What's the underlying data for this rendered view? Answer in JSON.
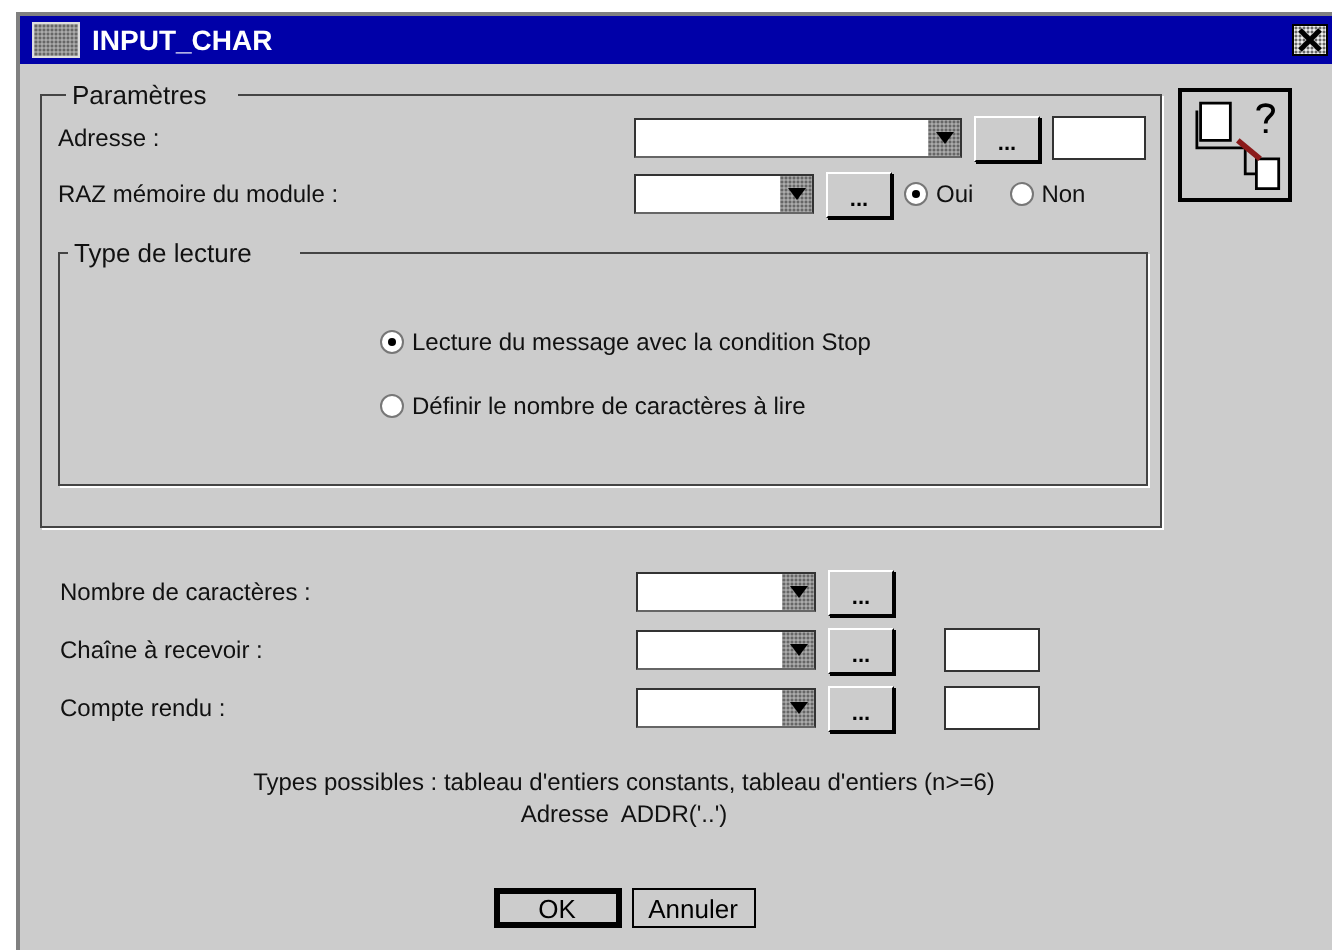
{
  "window": {
    "title": "INPUT_CHAR"
  },
  "parameters": {
    "title": "Paramètres",
    "fields": [
      {
        "kind": "wide",
        "label": "Adresse :",
        "button": "...",
        "has_box": true
      },
      {
        "kind": "radio",
        "label": "RAZ mémoire du module :",
        "button": "...",
        "options": [
          {
            "label": "Oui",
            "selected": true
          },
          {
            "label": "Non",
            "selected": false
          }
        ]
      }
    ]
  },
  "read_type": {
    "title": "Type de lecture",
    "options": [
      {
        "label": "Lecture du message avec la condition Stop",
        "selected": true
      },
      {
        "label": "Définir le nombre de caractères à lire",
        "selected": false
      }
    ]
  },
  "fields": [
    {
      "label": "Nombre de caractères :",
      "button": "...",
      "has_box": false
    },
    {
      "label": "Chaîne à recevoir :",
      "button": "...",
      "has_box": true
    },
    {
      "label": "Compte rendu :",
      "button": "...",
      "has_box": true
    }
  ],
  "hint": [
    "Types possibles : tableau d'entiers constants, tableau d'entiers (n>=6)",
    "Adresse  ADDR('..')"
  ],
  "buttons": [
    {
      "label": "OK",
      "default": true
    },
    {
      "label": "Annuler",
      "default": false
    }
  ]
}
